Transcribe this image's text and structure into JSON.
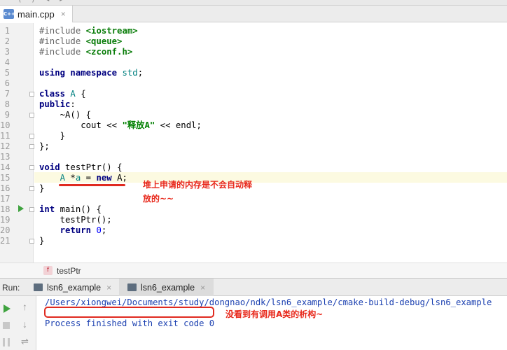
{
  "window": {
    "title_fragment": "⟨ ⟩ ◂ ▸"
  },
  "editor_tab": {
    "icon": "cpp-file-icon",
    "icon_text": "C++",
    "filename": "main.cpp",
    "close": "×"
  },
  "editor": {
    "current_line": 15,
    "lines": [
      {
        "n": "1",
        "code": [
          [
            "pp",
            "#include "
          ],
          [
            "inc",
            "<iostream>"
          ]
        ]
      },
      {
        "n": "2",
        "code": [
          [
            "pp",
            "#include "
          ],
          [
            "inc",
            "<queue>"
          ]
        ]
      },
      {
        "n": "3",
        "code": [
          [
            "pp",
            "#include "
          ],
          [
            "inc",
            "<zconf.h>"
          ]
        ]
      },
      {
        "n": "4",
        "code": []
      },
      {
        "n": "5",
        "code": [
          [
            "kw",
            "using namespace "
          ],
          [
            "cls",
            "std"
          ],
          [
            "plain",
            ";"
          ]
        ]
      },
      {
        "n": "6",
        "code": []
      },
      {
        "n": "7",
        "code": [
          [
            "kw",
            "class "
          ],
          [
            "cls",
            "A"
          ],
          [
            "plain",
            " {"
          ]
        ]
      },
      {
        "n": "8",
        "code": [
          [
            "kw",
            "public"
          ],
          [
            "plain",
            ":"
          ]
        ]
      },
      {
        "n": "9",
        "code": [
          [
            "plain",
            "    ~A() {"
          ]
        ]
      },
      {
        "n": "10",
        "code": [
          [
            "plain",
            "        cout << "
          ],
          [
            "str",
            "\"释放A\""
          ],
          [
            "plain",
            " << endl;"
          ]
        ]
      },
      {
        "n": "11",
        "code": [
          [
            "plain",
            "    }"
          ]
        ]
      },
      {
        "n": "12",
        "code": [
          [
            "plain",
            "};"
          ]
        ]
      },
      {
        "n": "13",
        "code": []
      },
      {
        "n": "14",
        "code": [
          [
            "kw",
            "void "
          ],
          [
            "plain",
            "testPtr() {"
          ]
        ]
      },
      {
        "n": "15",
        "code": [
          [
            "plain",
            "    "
          ],
          [
            "cls",
            "A"
          ],
          [
            "plain",
            " *"
          ],
          [
            "cls",
            "a"
          ],
          [
            "plain",
            " = "
          ],
          [
            "kw",
            "new "
          ],
          [
            "plain",
            "A;"
          ]
        ]
      },
      {
        "n": "16",
        "code": [
          [
            "plain",
            "}"
          ]
        ]
      },
      {
        "n": "17",
        "code": []
      },
      {
        "n": "18",
        "code": [
          [
            "kw",
            "int "
          ],
          [
            "plain",
            "main() {"
          ]
        ]
      },
      {
        "n": "19",
        "code": [
          [
            "plain",
            "    testPtr();"
          ]
        ]
      },
      {
        "n": "20",
        "code": [
          [
            "plain",
            "    "
          ],
          [
            "kw",
            "return "
          ],
          [
            "num",
            "0"
          ],
          [
            "plain",
            ";"
          ]
        ]
      },
      {
        "n": "21",
        "code": [
          [
            "plain",
            "}"
          ]
        ]
      }
    ],
    "annotation": "堆上申请的内存是不会自动释放的~~"
  },
  "breadcrumb": {
    "icon_text": "f",
    "function": "testPtr"
  },
  "run_panel": {
    "label": "Run:",
    "tabs": [
      {
        "label": "lsn6_example",
        "close": "×"
      },
      {
        "label": "lsn6_example",
        "close": "×"
      }
    ],
    "tools": {
      "up": "↑",
      "down": "↓",
      "wrap": "⇌"
    },
    "console": {
      "path": "/Users/xiongwei/Documents/study/dongnao/ndk/lsn6_example/cmake-build-debug/lsn6_example",
      "finished": "Process finished with exit code 0"
    },
    "annotation": "没看到有调用A类的析构~"
  },
  "colors": {
    "annotation_red": "#e8291c",
    "keyword": "#000080",
    "string": "#008000",
    "include": "#0a7d0a",
    "console_text": "#1a3fb0",
    "current_line_bg": "#fcfae1"
  }
}
